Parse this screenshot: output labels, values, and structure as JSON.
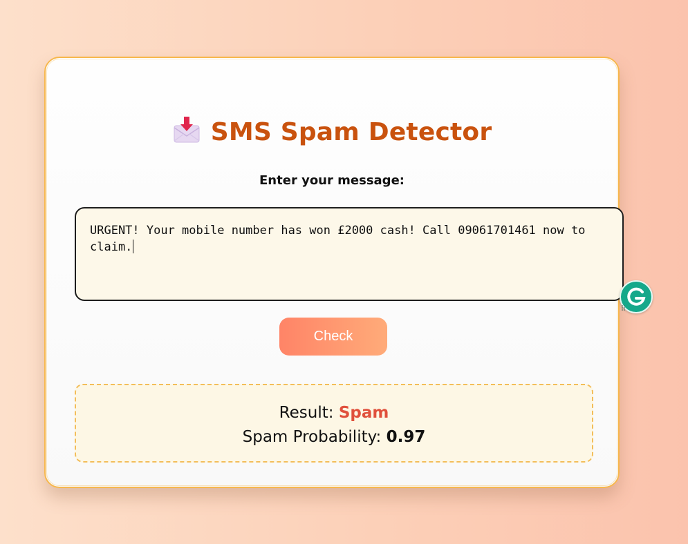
{
  "app": {
    "title": "SMS Spam Detector",
    "title_icon": "inbox-tray-icon",
    "accent_color": "#c9520e"
  },
  "form": {
    "label": "Enter your message:",
    "message_value": "URGENT! Your mobile number has won £2000 cash! Call 09061701461 now to claim.",
    "submit_label": "Check"
  },
  "result": {
    "result_label": "Result:",
    "result_value": "Spam",
    "result_color": "#e0503c",
    "probability_label": "Spam Probability:",
    "probability_value": "0.97"
  },
  "extension": {
    "icon": "grammarly-icon",
    "color": "#15a88a"
  }
}
